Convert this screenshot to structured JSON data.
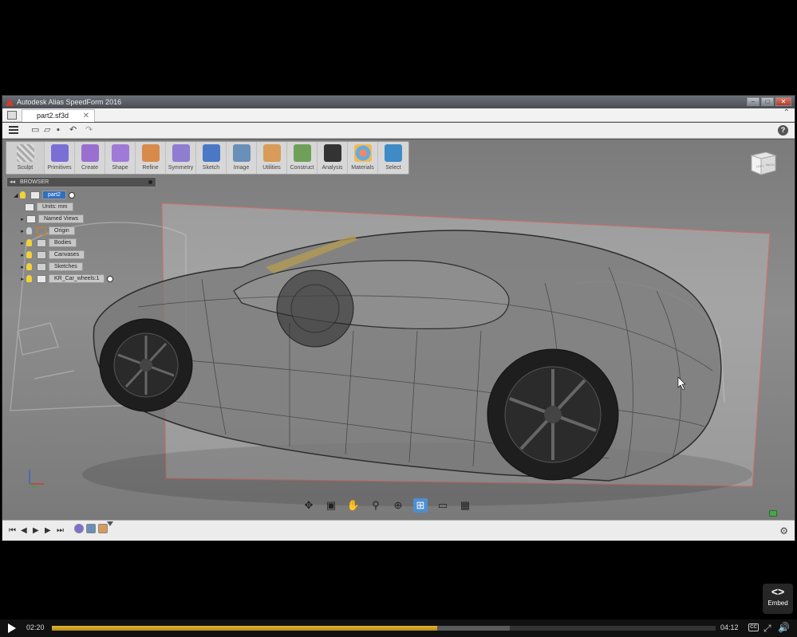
{
  "window": {
    "title": "Autodesk Alias SpeedForm 2016",
    "buttons": [
      "minimize",
      "maximize",
      "close"
    ]
  },
  "tab": {
    "name": "part2.sf3d",
    "close": "✕"
  },
  "ribbon": {
    "items": [
      {
        "label": "Sculpt",
        "color": "#c8c8c8"
      },
      {
        "label": "Primitives",
        "color": "#7b6fd6"
      },
      {
        "label": "Create",
        "color": "#9a6fd0"
      },
      {
        "label": "Shape",
        "color": "#9f7ad6"
      },
      {
        "label": "Refine",
        "color": "#d88a4a"
      },
      {
        "label": "Symmetry",
        "color": "#8f7dd0"
      },
      {
        "label": "Sketch",
        "color": "#4a78c4"
      },
      {
        "label": "Image",
        "color": "#6a8fb8"
      },
      {
        "label": "Utilities",
        "color": "#d89b5a"
      },
      {
        "label": "Construct",
        "color": "#6fa05a"
      },
      {
        "label": "Analysis",
        "color": "#333333"
      },
      {
        "label": "Materials",
        "color": "#d8a05a"
      },
      {
        "label": "Select",
        "color": "#3f8bc6"
      }
    ]
  },
  "browser": {
    "label": "BROWSER",
    "root": "part2",
    "nodes": [
      {
        "label": "Units: mm"
      },
      {
        "label": "Named Views"
      },
      {
        "label": "Origin"
      },
      {
        "label": "Bodies"
      },
      {
        "label": "Canvases"
      },
      {
        "label": "Sketches"
      },
      {
        "label": "KR_Car_wheels:1"
      }
    ]
  },
  "viewcube": {
    "left": "LEFT",
    "back": "BACK"
  },
  "player": {
    "current_time": "02:20",
    "total_time": "04:12",
    "played_fraction": 0.58,
    "buffered_fraction": 0.69,
    "embed_label": "Embed",
    "embed_icon": "<>",
    "cc_label": "CC"
  }
}
